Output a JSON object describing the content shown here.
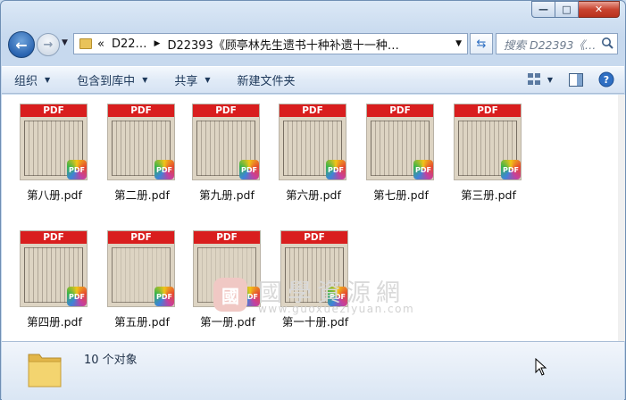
{
  "window": {
    "caption_buttons": {
      "minimize": "—",
      "maximize": "□",
      "close": "✕"
    }
  },
  "nav": {
    "back_icon": "back-arrow-icon",
    "forward_icon": "forward-arrow-icon",
    "address": {
      "overflow": "«",
      "crumb1": "D22…",
      "crumb2": "D22393《顾亭林先生遗书十种补遗十一种…"
    },
    "search_placeholder": "搜索 D22393《…"
  },
  "toolbar": {
    "organize": "组织",
    "include_library": "包含到库中",
    "share": "共享",
    "new_folder": "新建文件夹"
  },
  "files": [
    {
      "name": "第八册.pdf",
      "badge": "PDF",
      "band": "PDF"
    },
    {
      "name": "第二册.pdf",
      "badge": "PDF",
      "band": "PDF"
    },
    {
      "name": "第九册.pdf",
      "badge": "PDF",
      "band": "PDF"
    },
    {
      "name": "第六册.pdf",
      "badge": "PDF",
      "band": "PDF"
    },
    {
      "name": "第七册.pdf",
      "badge": "PDF",
      "band": "PDF"
    },
    {
      "name": "第三册.pdf",
      "badge": "PDF",
      "band": "PDF"
    },
    {
      "name": "第四册.pdf",
      "badge": "PDF",
      "band": "PDF"
    },
    {
      "name": "第五册.pdf",
      "badge": "PDF",
      "band": "PDF"
    },
    {
      "name": "第一册.pdf",
      "badge": "PDF",
      "band": "PDF"
    },
    {
      "name": "第一十册.pdf",
      "badge": "PDF",
      "band": "PDF"
    }
  ],
  "watermark": {
    "seal": "國",
    "text": "國學資源網",
    "url": "www.guoxueziyuan.com"
  },
  "status": {
    "count_text": "10 个对象"
  },
  "colors": {
    "pdf_band": "#d91e1e",
    "content_bg": "#ffffff",
    "toolbar_text": "#1e395b"
  }
}
